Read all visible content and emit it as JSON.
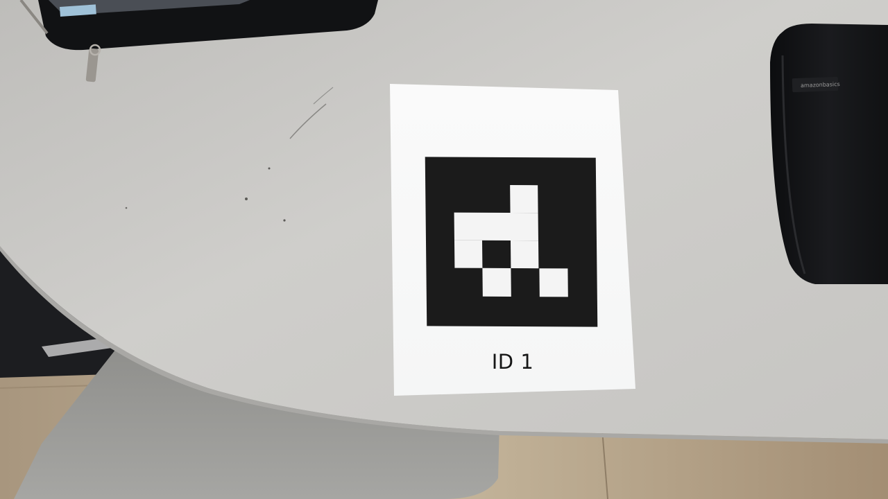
{
  "marker": {
    "id_label": "ID 1"
  },
  "case": {
    "brand": "amazonbasics"
  },
  "colors": {
    "table": "#c9c8c4",
    "floor": "#b9a98f",
    "marker_black": "#1b1b1b",
    "paper": "#f7f7f7",
    "case_black": "#141517"
  }
}
